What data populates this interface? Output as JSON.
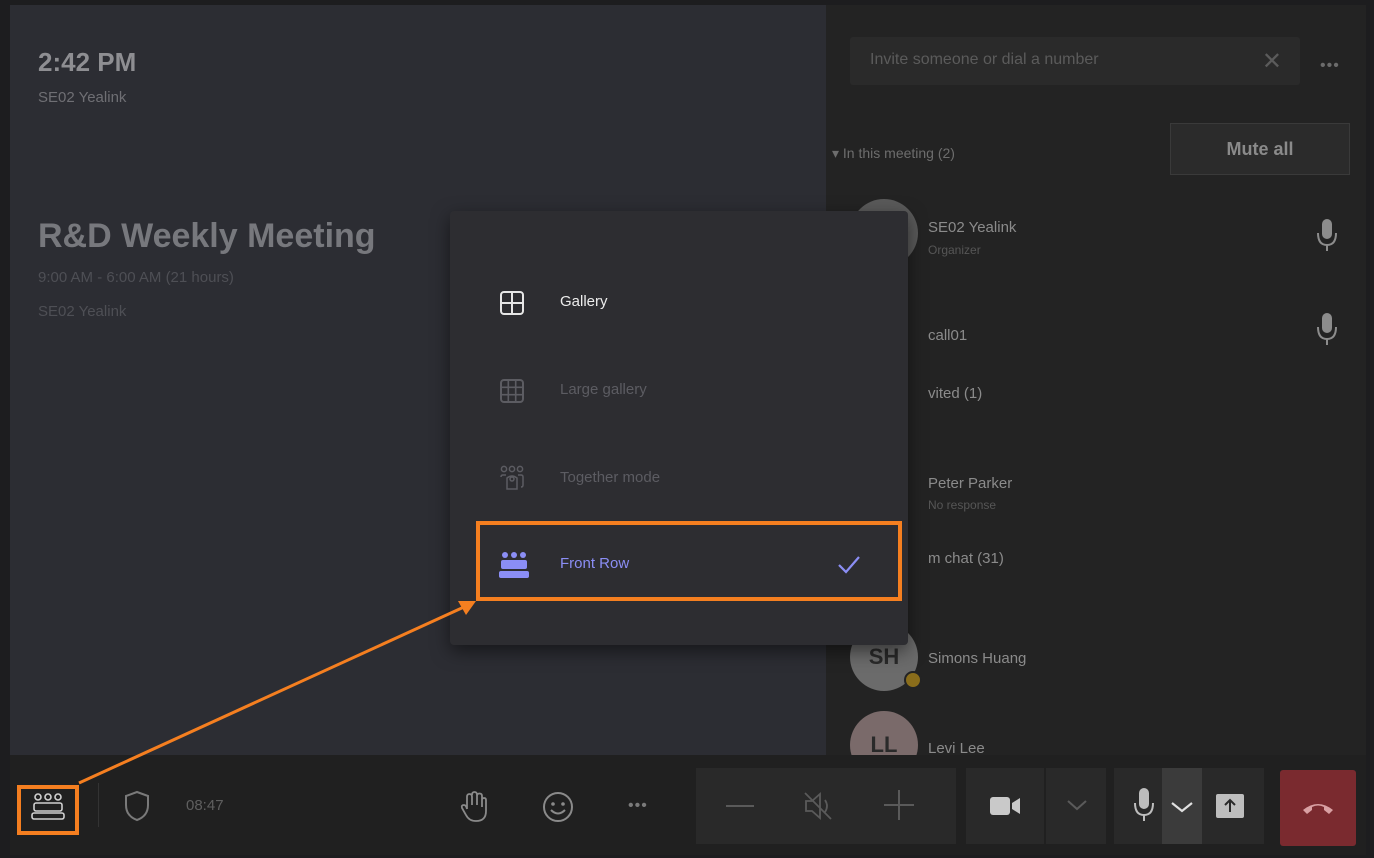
{
  "stage": {
    "clock": "2:42 PM",
    "room_name": "SE02 Yealink",
    "meeting_title": "R&D Weekly Meeting",
    "meeting_time": "9:00 AM - 6:00 AM (21 hours)",
    "meeting_organizer": "SE02 Yealink"
  },
  "roster": {
    "invite_placeholder": "Invite someone or dial a number",
    "section_in_meeting": "▾ In this meeting (2)",
    "mute_all_label": "Mute all",
    "participants": [
      {
        "initials": "",
        "name": "SE02 Yealink",
        "role": "Organizer"
      },
      {
        "initials": "",
        "name": "call01",
        "role": ""
      }
    ],
    "section_invited": "vited (1)",
    "invited": [
      {
        "name": "Peter Parker",
        "status": "No response"
      }
    ],
    "section_chat": "m chat (31)",
    "chat_members": [
      {
        "initials": "SH",
        "name": "Simons Huang"
      },
      {
        "initials": "LL",
        "name": "Levi Lee"
      }
    ]
  },
  "layout_menu": {
    "items": [
      {
        "label": "Gallery",
        "icon": "grid-2x2-icon",
        "state": "enabled"
      },
      {
        "label": "Large gallery",
        "icon": "grid-3x3-icon",
        "state": "disabled"
      },
      {
        "label": "Together mode",
        "icon": "together-mode-icon",
        "state": "disabled"
      },
      {
        "label": "Front Row",
        "icon": "front-row-icon",
        "state": "selected"
      }
    ]
  },
  "toolbar": {
    "timer": "08:47",
    "icons": [
      "front-row-icon",
      "shield-icon",
      "raise-hand-icon",
      "smiley-icon",
      "more-icon",
      "minus-icon",
      "speaker-muted-icon",
      "plus-icon",
      "camera-icon",
      "chevron-down-icon",
      "microphone-icon",
      "chevron-down-icon",
      "share-screen-icon",
      "hang-up-icon"
    ]
  },
  "colors": {
    "accent_purple": "#8b8ef5",
    "highlight_orange": "#f57f20",
    "hangup_red": "#7a2a2f"
  }
}
